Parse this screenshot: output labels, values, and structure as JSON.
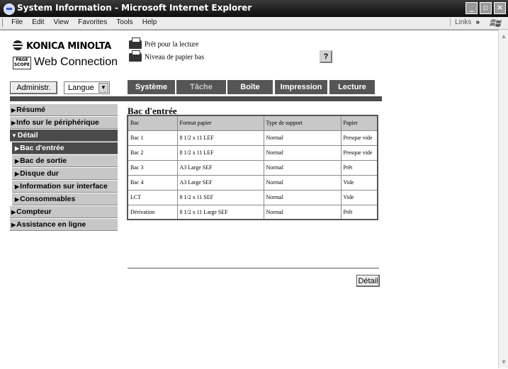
{
  "window": {
    "title": "System Information - Microsoft Internet Explorer",
    "controls": [
      "_",
      "▫",
      "×"
    ]
  },
  "menubar": {
    "items": [
      "File",
      "Edit",
      "View",
      "Favorites",
      "Tools",
      "Help"
    ],
    "links_label": "Links",
    "links_chevron": "»"
  },
  "header": {
    "brand": "KONICA MINOLTA",
    "pagescope_mark": "PAGE SCOPE",
    "product": "Web Connection",
    "status_ready": "Prêt pour la lecture",
    "status_paper": "Niveau de papier bas",
    "help_label": "?",
    "admin_button": "Administr.",
    "language_select": "Langue"
  },
  "tabs": [
    {
      "label": "Système",
      "state": "active"
    },
    {
      "label": "Tâche",
      "state": "dim"
    },
    {
      "label": "Boîte",
      "state": "normal"
    },
    {
      "label": "Impression",
      "state": "normal"
    },
    {
      "label": "Lecture",
      "state": "normal"
    }
  ],
  "sidebar": {
    "items": [
      {
        "label": "Résumé",
        "arrow": "▶"
      },
      {
        "label": "Info sur le périphérique",
        "arrow": "▶"
      },
      {
        "label": "Détail",
        "arrow": "▼"
      },
      {
        "label": "Bac d'entrée",
        "arrow": "▶"
      },
      {
        "label": "Bac de sortie",
        "arrow": "▶"
      },
      {
        "label": "Disque dur",
        "arrow": "▶"
      },
      {
        "label": "Information sur interface",
        "arrow": "▶"
      },
      {
        "label": "Consommables",
        "arrow": "▶"
      },
      {
        "label": "Compteur",
        "arrow": "▶"
      },
      {
        "label": "Assistance en ligne",
        "arrow": "▶"
      }
    ]
  },
  "main": {
    "heading": "Bac d'entrée",
    "table": {
      "headers": [
        "Bac",
        "Format papier",
        "Type de support",
        "Papier"
      ],
      "rows": [
        [
          "Bac 1",
          "8 1/2 x 11 LEF",
          "Normal",
          "Presque vide"
        ],
        [
          "Bac 2",
          "8 1/2 x 11 LEF",
          "Normal",
          "Presque vide"
        ],
        [
          "Bac 3",
          "A3 Large SEF",
          "Normal",
          "Prêt"
        ],
        [
          "Bac 4",
          "A3 Large SEF",
          "Normal",
          "Vide"
        ],
        [
          "LCT",
          "8 1/2 x 11 SEF",
          "Normal",
          "Vide"
        ],
        [
          "Dérivation",
          "8 1/2 x 11 Large SEF",
          "Normal",
          "Prêt"
        ]
      ]
    },
    "detail_button": "Détail"
  },
  "colors": {
    "tab_bg": "#555555",
    "sidebar_bg": "#c7c7c7",
    "sidebar_active": "#4a4a4a",
    "table_header_bg": "#c8c8c8"
  },
  "icons": [
    "ie-logo-icon",
    "printer-icon",
    "help-icon",
    "dropdown-arrow-icon",
    "windows-logo-icon"
  ]
}
